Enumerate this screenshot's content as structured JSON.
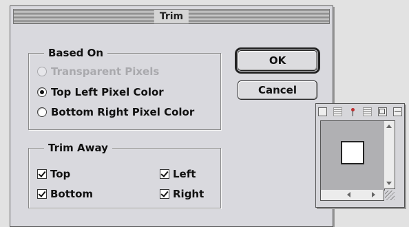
{
  "dialog": {
    "title": "Trim",
    "based_on": {
      "label": "Based On",
      "options": [
        {
          "label": "Transparent Pixels",
          "selected": false,
          "disabled": true
        },
        {
          "label": "Top Left Pixel Color",
          "selected": true,
          "disabled": false
        },
        {
          "label": "Bottom Right Pixel Color",
          "selected": false,
          "disabled": false
        }
      ]
    },
    "trim_away": {
      "label": "Trim Away",
      "top": {
        "label": "Top",
        "checked": true
      },
      "bottom": {
        "label": "Bottom",
        "checked": true
      },
      "left": {
        "label": "Left",
        "checked": true
      },
      "right": {
        "label": "Right",
        "checked": true
      }
    },
    "ok_label": "OK",
    "cancel_label": "Cancel"
  },
  "palette": {
    "icons": [
      "window-icon",
      "layers-icon",
      "pin-icon",
      "list-icon",
      "view-icon",
      "grid-icon"
    ]
  }
}
